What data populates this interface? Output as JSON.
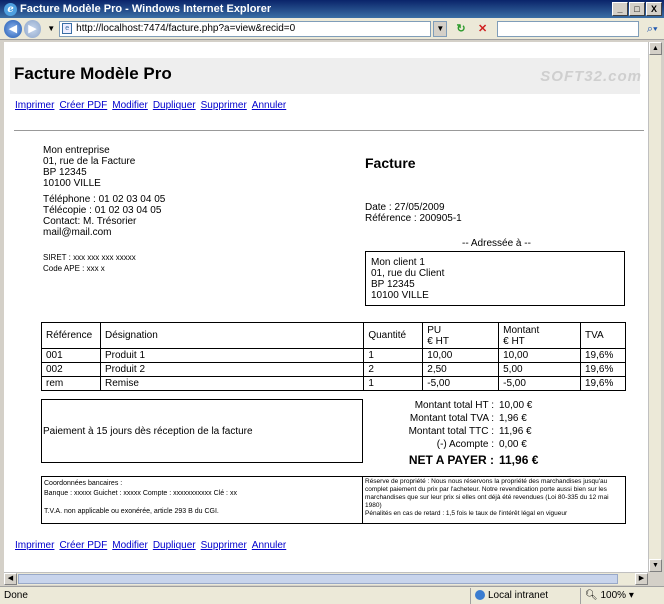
{
  "window": {
    "title": "Facture Modèle Pro - Windows Internet Explorer",
    "minimize": "_",
    "maximize": "□",
    "close": "X"
  },
  "nav": {
    "back": "◀",
    "forward": "▶",
    "url": "http://localhost:7474/facture.php?a=view&recid=0",
    "search_value": ""
  },
  "page": {
    "title": "Facture Modèle Pro",
    "watermark": "SOFT32.com",
    "actions": [
      "Imprimer",
      "Créer PDF",
      "Modifier",
      "Dupliquer",
      "Supprimer",
      "Annuler"
    ],
    "company": {
      "name": "Mon entreprise",
      "street": "01, rue de la Facture",
      "po_box": "BP 12345",
      "city": "10100 VILLE",
      "phone": "Téléphone : 01 02 03 04 05",
      "fax": "Télécopie : 01 02 03 04 05",
      "contact": "Contact: M. Trésorier",
      "email": "mail@mail.com",
      "siret": "SIRET : xxx xxx xxx xxxxx",
      "ape": "Code APE : xxx x"
    },
    "doc_title": "Facture",
    "date": "Date : 27/05/2009",
    "reference": "Référence : 200905-1",
    "addressed_to": "-- Adressée à --",
    "client": {
      "name": "Mon client 1",
      "street": "01, rue du Client",
      "po_box": "BP 12345",
      "city": "10100 VILLE"
    },
    "table": {
      "headers": {
        "ref": "Référence",
        "designation": "Désignation",
        "qty": "Quantité",
        "pu_1": "PU",
        "pu_2": "€ HT",
        "amount_1": "Montant",
        "amount_2": "€ HT",
        "vat": "TVA"
      },
      "rows": [
        {
          "ref": "001",
          "designation": "Produit 1",
          "qty": "1",
          "pu": "10,00",
          "amount": "10,00",
          "vat": "19,6%"
        },
        {
          "ref": "002",
          "designation": "Produit 2",
          "qty": "2",
          "pu": "2,50",
          "amount": "5,00",
          "vat": "19,6%"
        },
        {
          "ref": "rem",
          "designation": "Remise",
          "qty": "1",
          "pu": "-5,00",
          "amount": "-5,00",
          "vat": "19,6%"
        }
      ]
    },
    "payment_terms": "Paiement à 15 jours dès réception de la facture",
    "totals": {
      "ht_label": "Montant total HT :",
      "ht_value": "10,00 €",
      "tva_label": "Montant total TVA :",
      "tva_value": "1,96 €",
      "ttc_label": "Montant total TTC :",
      "ttc_value": "11,96 €",
      "deposit_label": "(-) Acompte :",
      "deposit_value": "0,00 €",
      "due_label": "NET A PAYER :",
      "due_value": "11,96 €"
    },
    "bank": {
      "title": "Coordonnées bancaires :",
      "details": "Banque : xxxxx Guichet : xxxxx Compte : xxxxxxxxxxx Clé : xx",
      "vat_note": "T.V.A. non applicable ou exonérée, article 293 B du CGI."
    },
    "legal": {
      "retention": "Réserve de propriété : Nous nous réservons la propriété des marchandises jusqu'au complet paiement du prix par l'acheteur. Notre revendication porte aussi bien sur les marchandises que sur leur prix si elles ont déjà été revendues (Loi 80-335 du 12 mai 1980)",
      "penalties": "Pénalités en cas de retard : 1,5 fois le taux de l'intérêt légal en vigueur"
    }
  },
  "status": {
    "text": "Done",
    "zone": "Local intranet",
    "zoom": "100%"
  },
  "colors": {
    "link": "#0000cc",
    "titlebar": "#0a246a",
    "header_band": "#eeeeee"
  }
}
